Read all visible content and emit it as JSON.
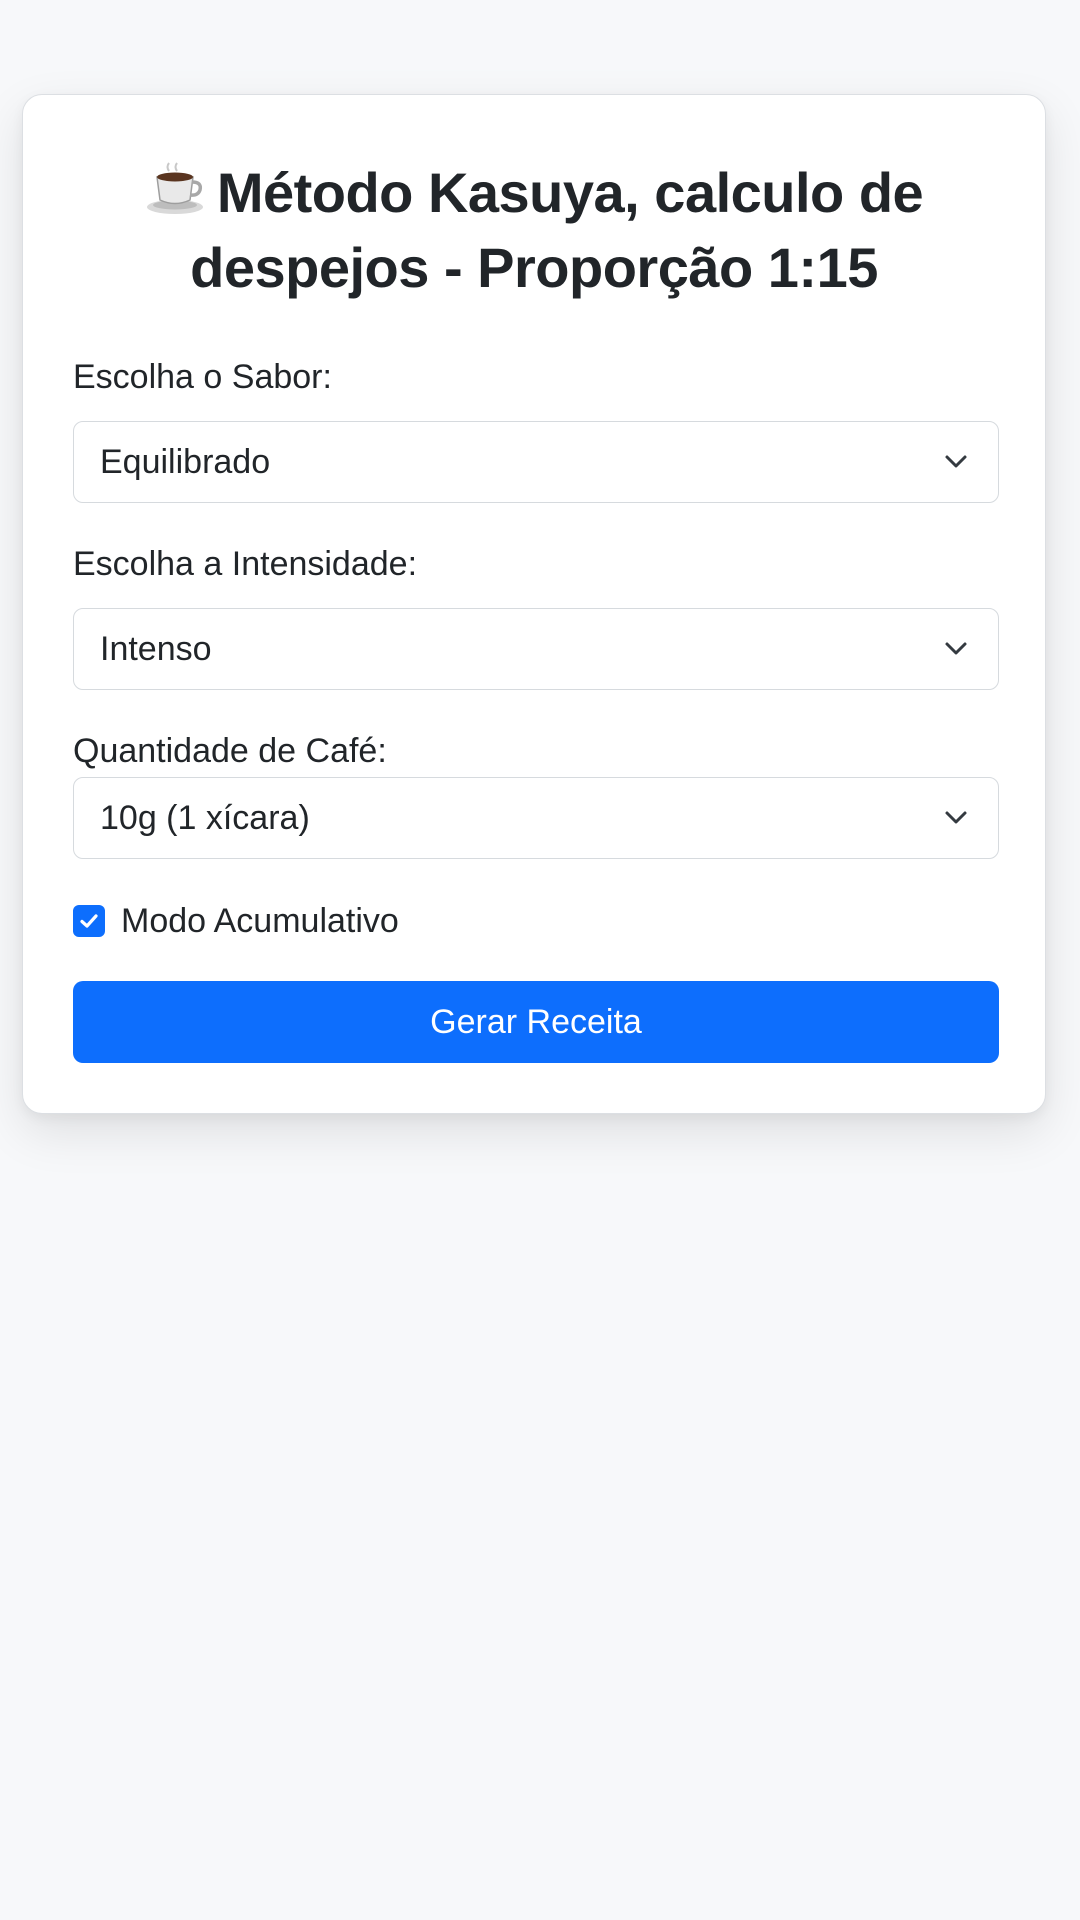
{
  "title": {
    "icon": "coffee-cup-icon",
    "line1": "Método Kasuya, calculo de",
    "line2": "despejos - Proporção 1:15"
  },
  "form": {
    "sabor": {
      "label": "Escolha o Sabor:",
      "value": "Equilibrado"
    },
    "intensidade": {
      "label": "Escolha a Intensidade:",
      "value": "Intenso"
    },
    "quantidade": {
      "label": "Quantidade de Café:",
      "value": "10g (1 xícara)"
    },
    "modo_acumulativo": {
      "label": "Modo Acumulativo",
      "checked": true
    },
    "submit_label": "Gerar Receita"
  },
  "colors": {
    "accent": "#0d6efd",
    "background": "#f7f8fa",
    "card": "#ffffff",
    "text": "#212529"
  }
}
